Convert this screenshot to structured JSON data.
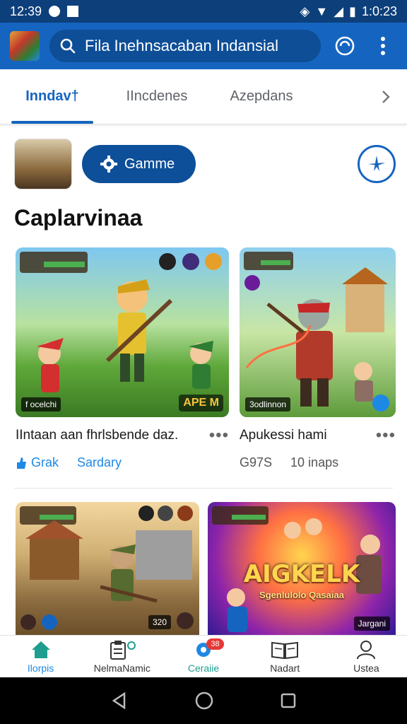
{
  "status_bar": {
    "time_left": "12:39",
    "time_right": "1:0:23"
  },
  "app_bar": {
    "search_text": "Fila Inehnsacaban Indansial"
  },
  "tabs": [
    {
      "label": "Inndav†",
      "active": true
    },
    {
      "label": "IIncdenes",
      "active": false
    },
    {
      "label": "Azepdans",
      "active": false
    }
  ],
  "profile": {
    "game_button": "Gamme"
  },
  "section_title": "Caplarvinaa",
  "cards": [
    {
      "title": "IIntaan aan fhrlsbende daz.",
      "badge": "f  ocelchi",
      "tag": "APE M",
      "meta": [
        {
          "text": "Grak",
          "icon": "thumb-up-icon"
        },
        {
          "text": "Sardary"
        }
      ]
    },
    {
      "title": "Apukessi hami",
      "badge": "3odlinnon",
      "meta": [
        {
          "text": "G97S"
        },
        {
          "text": "10 inaps"
        }
      ]
    },
    {
      "title": "",
      "badge": "320",
      "meta": []
    },
    {
      "title": "",
      "art_text": "AIGKELK",
      "art_sub": "Sgenlulolo Qasaiaa",
      "badge": "Jargani",
      "meta": []
    }
  ],
  "bottom_nav": [
    {
      "label": "Ilorpis",
      "icon": "home-icon",
      "active": true
    },
    {
      "label": "NelmaNamic",
      "icon": "clipboard-icon",
      "active": false
    },
    {
      "label": "Ceraiie",
      "icon": "gear-icon",
      "active": true,
      "badge": "38"
    },
    {
      "label": "Nadart",
      "icon": "book-icon",
      "active": false
    },
    {
      "label": "Ustea",
      "icon": "person-icon",
      "active": false
    }
  ],
  "colors": {
    "primary": "#1565c0",
    "status_bar": "#0d3f7a",
    "accent_link": "#1e88e5"
  }
}
